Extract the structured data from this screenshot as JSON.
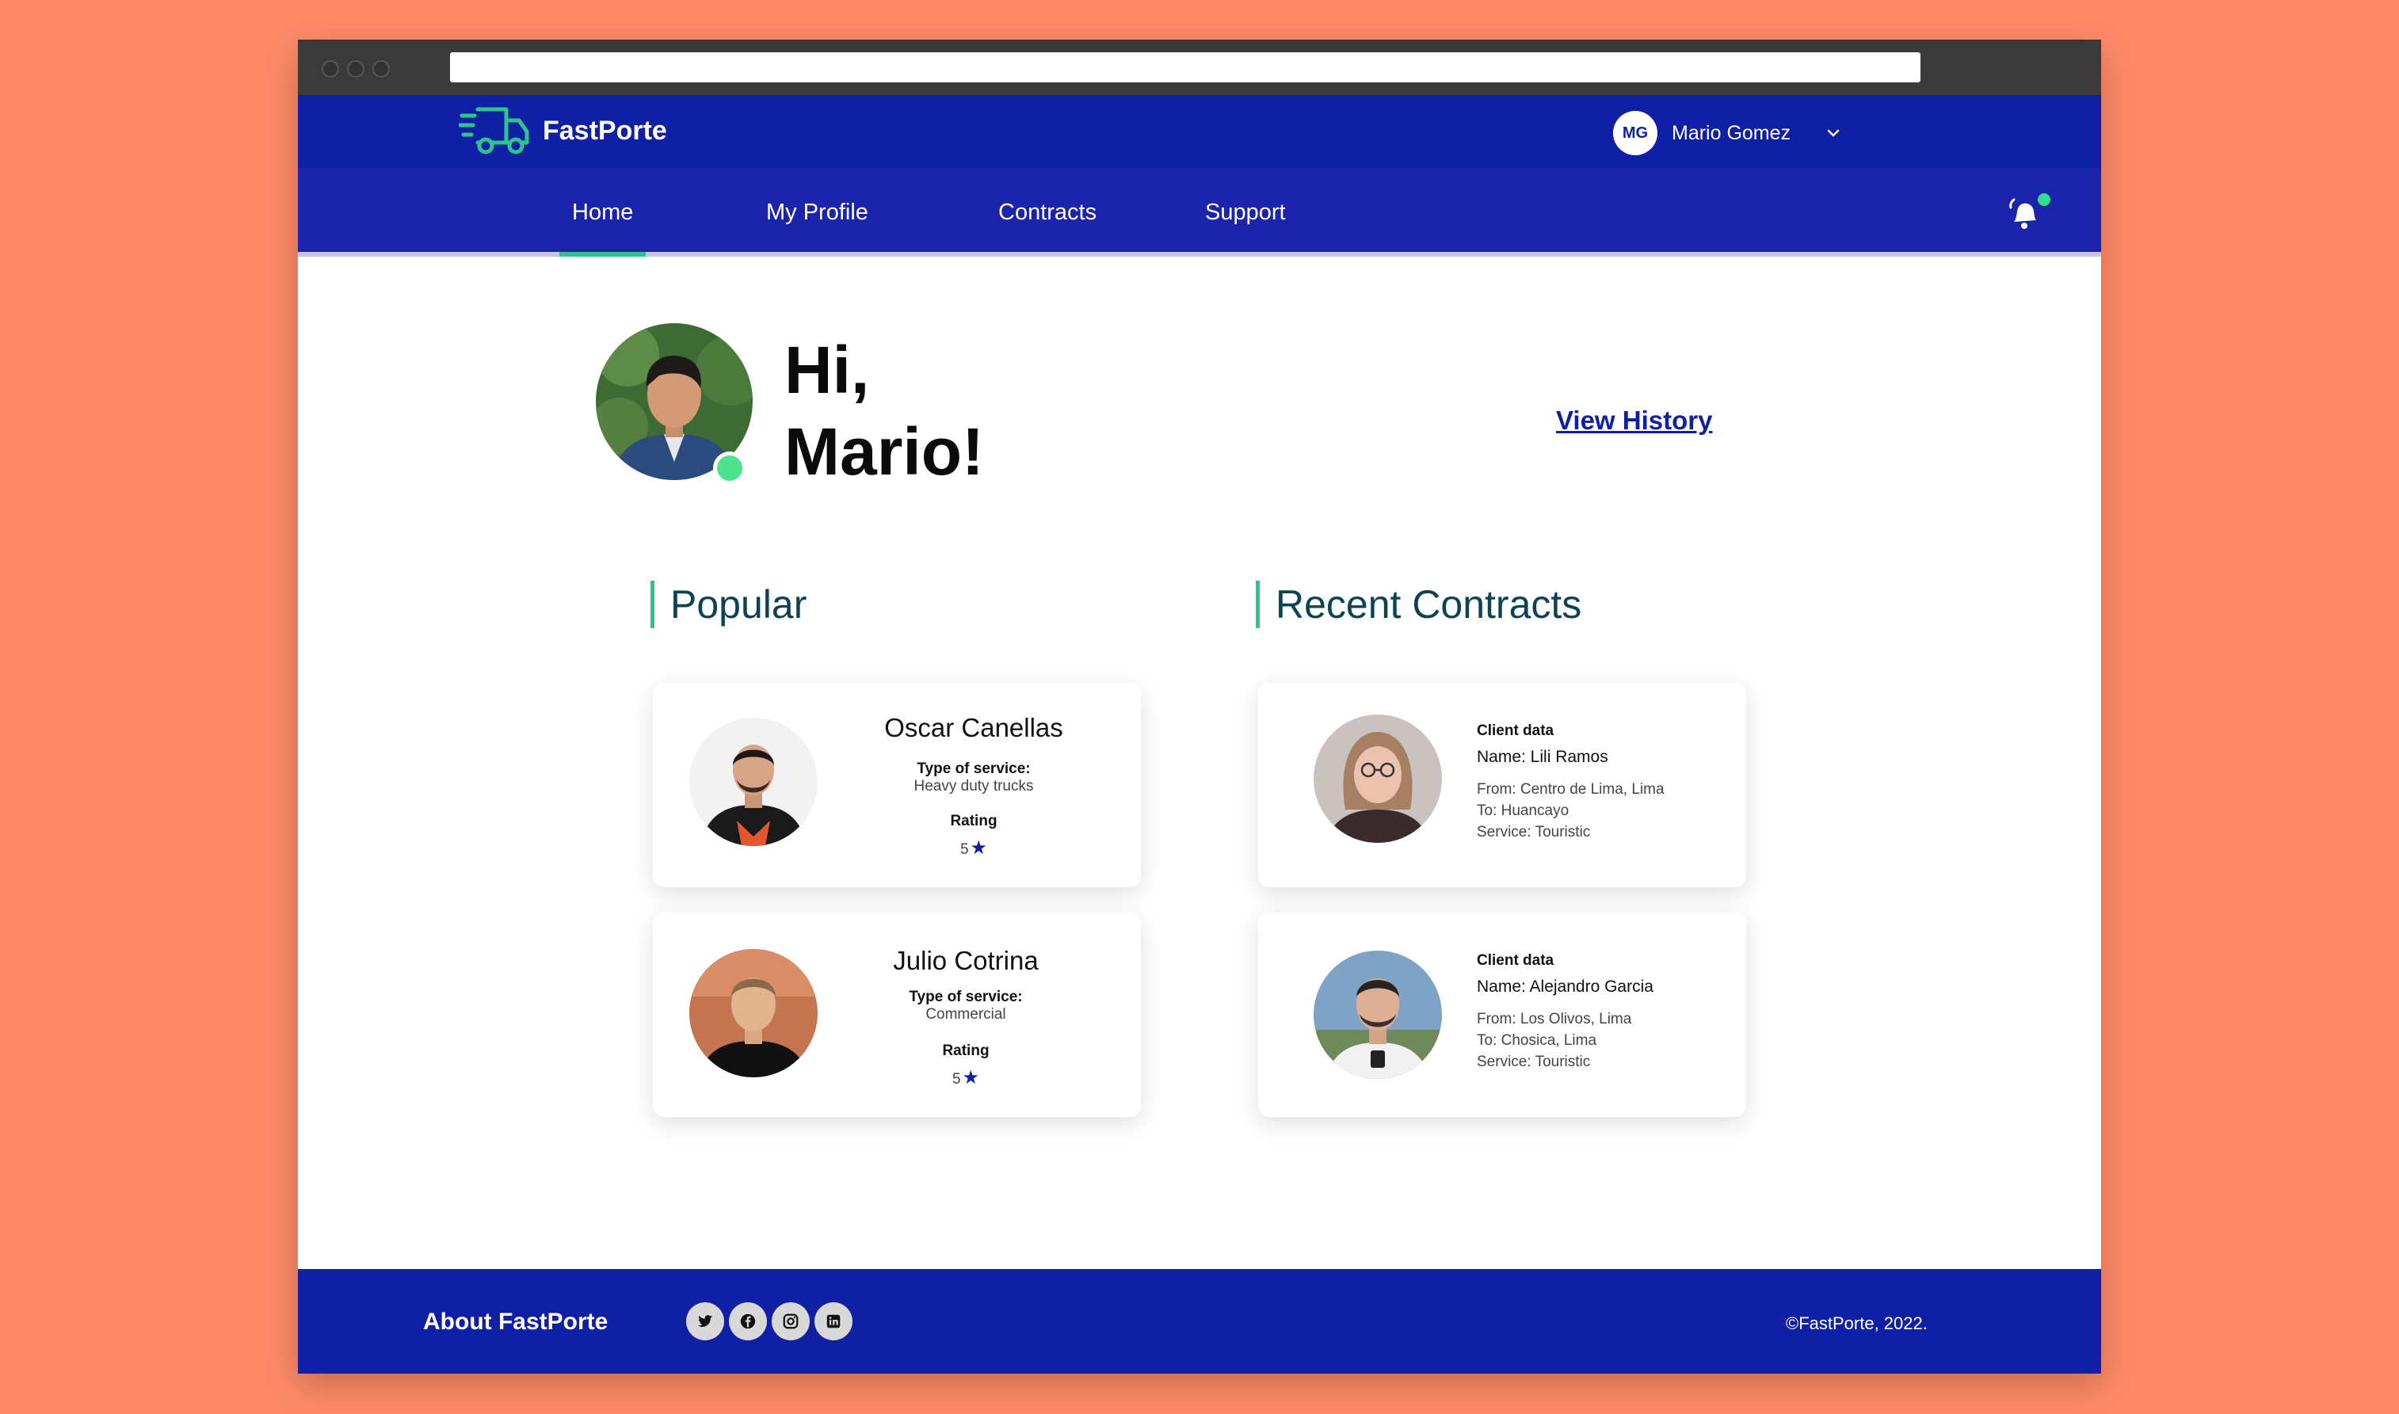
{
  "app": {
    "name": "FastPorte"
  },
  "user": {
    "initials": "MG",
    "name": "Mario Gomez"
  },
  "nav": {
    "items": [
      {
        "label": "Home",
        "active": true
      },
      {
        "label": "My Profile",
        "active": false
      },
      {
        "label": "Contracts",
        "active": false
      },
      {
        "label": "Support",
        "active": false
      }
    ]
  },
  "hero": {
    "greeting_line1": "Hi,",
    "greeting_line2": "Mario!",
    "view_history": "View History"
  },
  "popular": {
    "title": "Popular",
    "cards": [
      {
        "name": "Oscar Canellas",
        "service_label": "Type of service:",
        "service": "Heavy duty trucks",
        "rating_label": "Rating",
        "rating": "5"
      },
      {
        "name": "Julio Cotrina",
        "service_label": "Type of service:",
        "service": "Commercial",
        "rating_label": "Rating",
        "rating": "5"
      }
    ]
  },
  "recent": {
    "title": "Recent Contracts",
    "cards": [
      {
        "heading": "Client data",
        "name": "Name: Lili Ramos",
        "from": "From: Centro de Lima, Lima",
        "to": "To: Huancayo",
        "service": "Service: Touristic"
      },
      {
        "heading": "Client data",
        "name": "Name: Alejandro Garcia",
        "from": "From: Los Olivos, Lima",
        "to": "To: Chosica, Lima",
        "service": "Service: Touristic"
      }
    ]
  },
  "footer": {
    "about": "About FastPorte",
    "copyright": "©FastPorte, 2022.",
    "socials": [
      "twitter-icon",
      "facebook-icon",
      "instagram-icon",
      "linkedin-icon"
    ]
  },
  "colors": {
    "primary": "#1020A4",
    "accent": "#2DC48D",
    "background": "#FE8A67",
    "online": "#4CE28E"
  }
}
